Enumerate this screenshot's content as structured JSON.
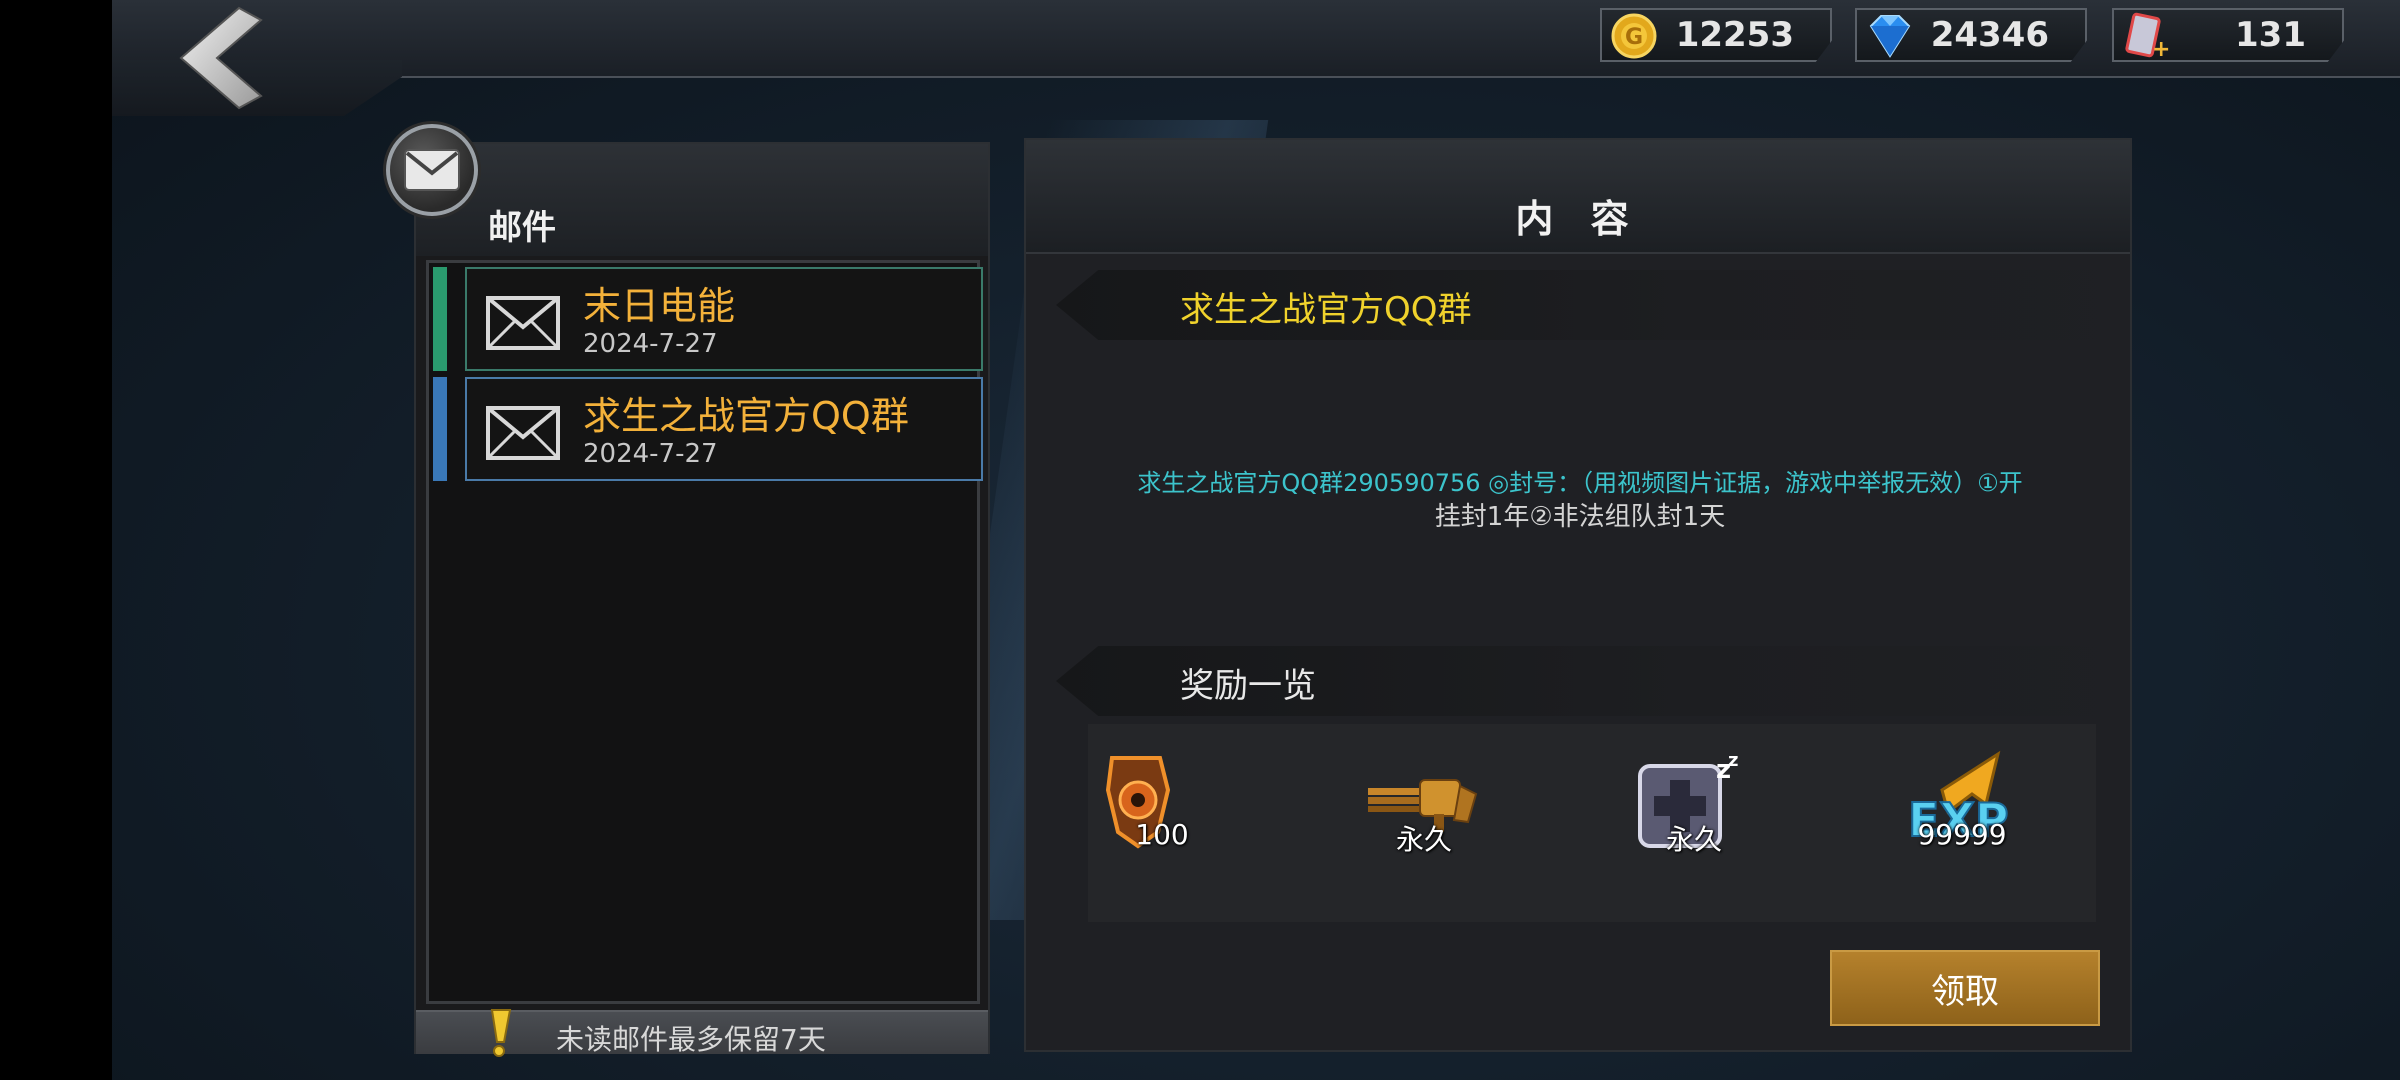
{
  "header": {
    "back_icon": "chevron-left-icon",
    "currencies": [
      {
        "icon": "gold-coin-icon",
        "value": "12253"
      },
      {
        "icon": "diamond-icon",
        "value": "24346"
      },
      {
        "icon": "ticket-icon",
        "value": "131"
      }
    ]
  },
  "mail_panel": {
    "title": "邮件",
    "icon": "mail-icon",
    "items": [
      {
        "subject": "末日电能",
        "date": "2024-7-27",
        "stripe_color": "#2a9a6e"
      },
      {
        "subject": "求生之战官方QQ群",
        "date": "2024-7-27",
        "stripe_color": "#3a78b8"
      }
    ],
    "footer_note": "未读邮件最多保留7天"
  },
  "content_panel": {
    "title": "内 容",
    "subject": "求生之战官方QQ群",
    "body_line1": "求生之战官方QQ群290590756 ◎封号：（用视频图片证据，游戏中举报无效）①开",
    "body_line2": "挂封1年②非法组队封1天",
    "rewards_title": "奖励一览",
    "rewards": [
      {
        "icon": "shield-token-icon",
        "qty": "100"
      },
      {
        "icon": "gatling-gun-icon",
        "qty": "永久"
      },
      {
        "icon": "medkit-icon",
        "qty": "永久"
      },
      {
        "icon": "exp-icon",
        "qty": "99999"
      }
    ],
    "claim_label": "领取"
  },
  "colors": {
    "accent_orange": "#f3b13a",
    "subject_yellow": "#f0d22c",
    "body_cyan": "#3cc4cc",
    "claim_button": "#a57424"
  }
}
